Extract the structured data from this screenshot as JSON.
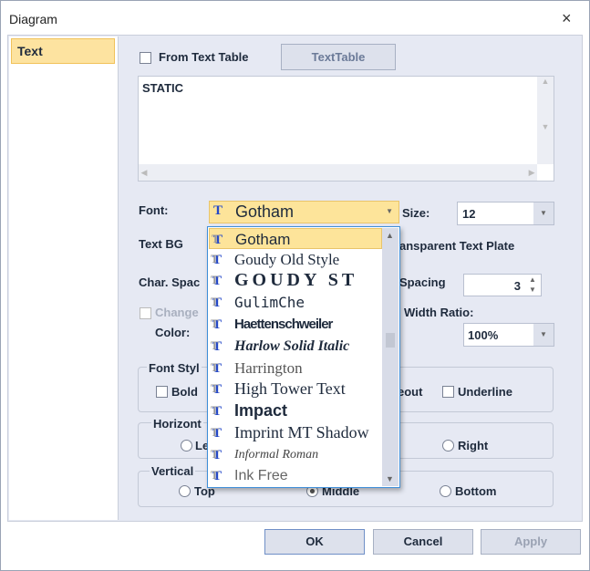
{
  "window": {
    "title": "Diagram",
    "close": "×"
  },
  "sidebar": {
    "items": [
      {
        "label": "Text"
      }
    ]
  },
  "from_text_table": {
    "label": "From Text Table",
    "checked": false
  },
  "text_table_button": "TextTable",
  "text_value": "STATIC",
  "font": {
    "label": "Font:",
    "value": "Gotham"
  },
  "size": {
    "label": "Size:",
    "value": "12"
  },
  "font_list": [
    {
      "name": "Gotham",
      "selected": true
    },
    {
      "name": "Goudy Old Style"
    },
    {
      "name": "GOUDY ST"
    },
    {
      "name": "GulimChe"
    },
    {
      "name": "Haettenschweiler"
    },
    {
      "name": "Harlow Solid Italic"
    },
    {
      "name": "Harrington"
    },
    {
      "name": "High Tower Text"
    },
    {
      "name": "Impact"
    },
    {
      "name": "Imprint MT Shadow"
    },
    {
      "name": "Informal Roman"
    },
    {
      "name": "Ink Free"
    }
  ],
  "labels": {
    "text_bg": "Text BG",
    "transparent": "ansparent Text Plate",
    "char_spacing": "Char. Spac",
    "spacing": "Spacing",
    "change": "Change",
    "color": "Color:",
    "width_ratio": "Width Ratio:",
    "font_style": "Font Styl",
    "horizontal": "Horizont",
    "vertical": "Vertical"
  },
  "spacing_value": "3",
  "width_ratio_value": "100%",
  "font_style": {
    "bold": "Bold",
    "strikeout": "eout",
    "underline": "Underline"
  },
  "horizontal": {
    "left": "Le",
    "right": "Right"
  },
  "vertical": {
    "top": "Top",
    "middle": "Middle",
    "bottom": "Bottom",
    "selected": "Middle"
  },
  "buttons": {
    "ok": "OK",
    "cancel": "Cancel",
    "apply": "Apply"
  }
}
